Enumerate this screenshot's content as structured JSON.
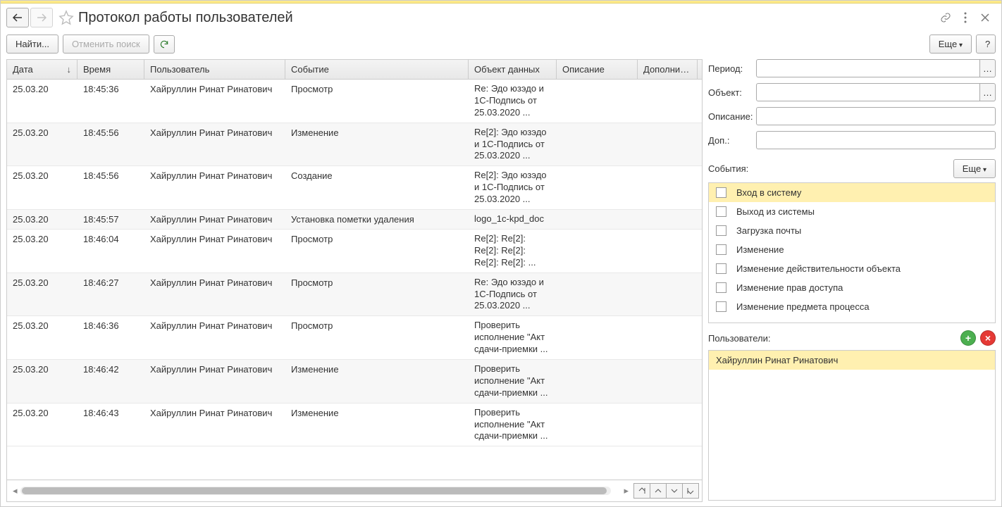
{
  "title": "Протокол работы пользователей",
  "toolbar": {
    "find": "Найти...",
    "cancel_search": "Отменить поиск",
    "more": "Еще",
    "help": "?"
  },
  "columns": {
    "date": "Дата",
    "time": "Время",
    "user": "Пользователь",
    "event": "Событие",
    "obj": "Объект данных",
    "desc": "Описание",
    "extra": "Дополнител"
  },
  "rows": [
    {
      "date": "25.03.20",
      "time": "18:45:36",
      "user": "Хайруллин Ринат Ринатович",
      "event": "Просмотр",
      "obj": "Re: Эдо юзэдо и 1С-Подпись от 25.03.2020 ..."
    },
    {
      "date": "25.03.20",
      "time": "18:45:56",
      "user": "Хайруллин Ринат Ринатович",
      "event": "Изменение",
      "obj": "Re[2]: Эдо юзэдо и 1С-Подпись от 25.03.2020 ..."
    },
    {
      "date": "25.03.20",
      "time": "18:45:56",
      "user": "Хайруллин Ринат Ринатович",
      "event": "Создание",
      "obj": "Re[2]: Эдо юзэдо и 1С-Подпись от 25.03.2020 ..."
    },
    {
      "date": "25.03.20",
      "time": "18:45:57",
      "user": "Хайруллин Ринат Ринатович",
      "event": "Установка пометки удаления",
      "obj": "logo_1c-kpd_doc"
    },
    {
      "date": "25.03.20",
      "time": "18:46:04",
      "user": "Хайруллин Ринат Ринатович",
      "event": "Просмотр",
      "obj": "Re[2]: Re[2]: Re[2]: Re[2]: Re[2]: Re[2]: ..."
    },
    {
      "date": "25.03.20",
      "time": "18:46:27",
      "user": "Хайруллин Ринат Ринатович",
      "event": "Просмотр",
      "obj": "Re: Эдо юзэдо и 1С-Подпись от 25.03.2020 ..."
    },
    {
      "date": "25.03.20",
      "time": "18:46:36",
      "user": "Хайруллин Ринат Ринатович",
      "event": "Просмотр",
      "obj": "Проверить исполнение \"Акт сдачи-приемки ..."
    },
    {
      "date": "25.03.20",
      "time": "18:46:42",
      "user": "Хайруллин Ринат Ринатович",
      "event": "Изменение",
      "obj": "Проверить исполнение \"Акт сдачи-приемки ..."
    },
    {
      "date": "25.03.20",
      "time": "18:46:43",
      "user": "Хайруллин Ринат Ринатович",
      "event": "Изменение",
      "obj": "Проверить исполнение \"Акт сдачи-приемки ..."
    }
  ],
  "filters": {
    "period_label": "Период:",
    "object_label": "Объект:",
    "desc_label": "Описание:",
    "extra_label": "Доп.:",
    "events_label": "События:",
    "events_more": "Еще",
    "users_label": "Пользователи:"
  },
  "events_list": [
    "Вход в систему",
    "Выход из системы",
    "Загрузка почты",
    "Изменение",
    "Изменение действительности объекта",
    "Изменение прав доступа",
    "Изменение предмета процесса"
  ],
  "users_list": [
    "Хайруллин Ринат Ринатович"
  ]
}
